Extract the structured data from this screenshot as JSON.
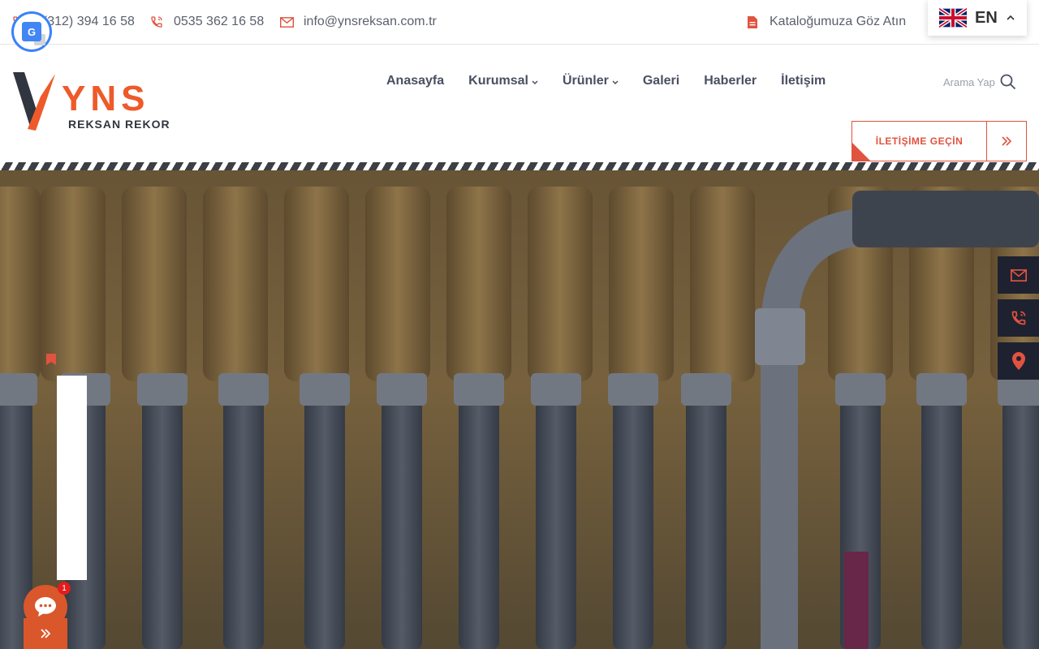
{
  "topbar": {
    "phone1": "0(312) 394 16 58",
    "phone2": "0535 362 16 58",
    "email": "info@ynsreksan.com.tr",
    "catalog": "Kataloğumuza Göz Atın"
  },
  "language": {
    "code": "EN",
    "flag": "uk-flag-icon"
  },
  "brand": {
    "name": "YNS",
    "tagline": "REKSAN REKOR",
    "accent": "#ee5a2a",
    "dark": "#30353f"
  },
  "nav": {
    "home": "Anasayfa",
    "corporate": "Kurumsal",
    "products": "Ürünler",
    "gallery": "Galeri",
    "news": "Haberler",
    "contact": "İletişim"
  },
  "search": {
    "label": "Arama Yap"
  },
  "cta": {
    "label": "İLETİŞİME GEÇİN",
    "color": "#e0533f"
  },
  "hero": {
    "image": "hydraulic-hoses-photo"
  },
  "side_buttons": [
    "mail-icon",
    "phone-icon",
    "location-icon"
  ],
  "chat": {
    "badge": "1"
  }
}
